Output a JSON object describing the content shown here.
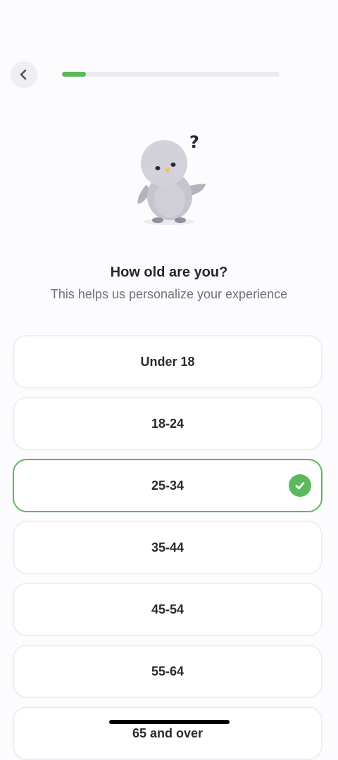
{
  "header": {
    "back_icon": "chevron-left-icon",
    "progress_fraction": 0.11
  },
  "mascot": {
    "badge": "?"
  },
  "question": {
    "title": "How old are you?",
    "subtitle": "This helps us personalize your experience"
  },
  "options": [
    {
      "label": "Under 18",
      "selected": false
    },
    {
      "label": "18-24",
      "selected": false
    },
    {
      "label": "25-34",
      "selected": true
    },
    {
      "label": "35-44",
      "selected": false
    },
    {
      "label": "45-54",
      "selected": false
    },
    {
      "label": "55-64",
      "selected": false
    },
    {
      "label": "65 and over",
      "selected": false
    }
  ],
  "colors": {
    "accent": "#5cb85c",
    "background": "#fcfbfd",
    "card_border": "#efeef2",
    "title": "#28272d",
    "subtitle": "#717078"
  }
}
